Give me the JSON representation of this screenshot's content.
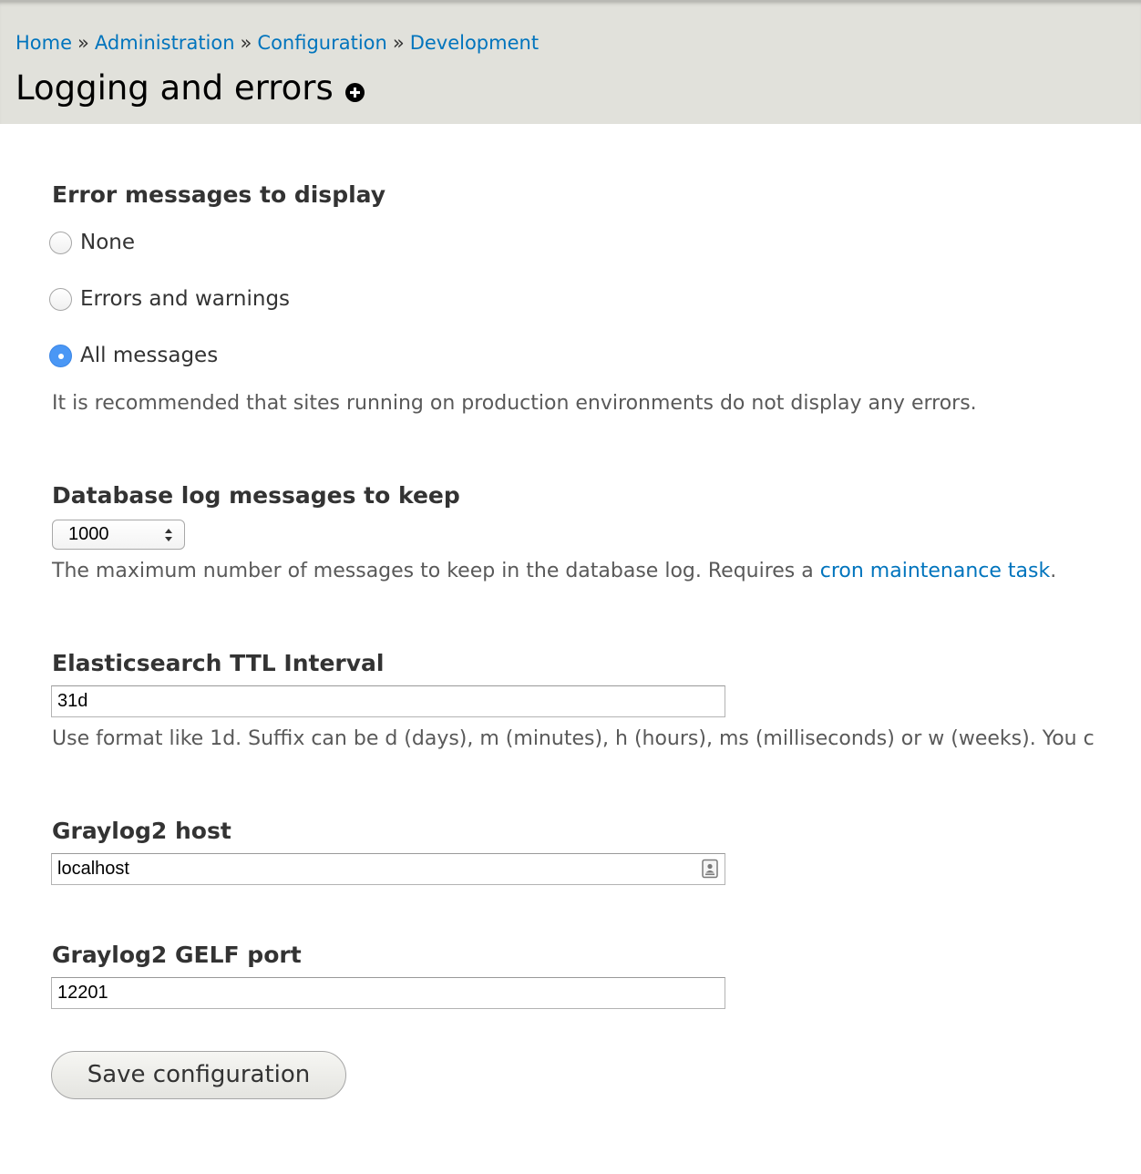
{
  "breadcrumb": {
    "items": [
      "Home",
      "Administration",
      "Configuration",
      "Development"
    ],
    "separator": "»"
  },
  "page": {
    "title": "Logging and errors"
  },
  "error_display": {
    "label": "Error messages to display",
    "options": [
      "None",
      "Errors and warnings",
      "All messages"
    ],
    "selected": "All messages",
    "description": "It is recommended that sites running on production environments do not display any errors."
  },
  "db_log": {
    "label": "Database log messages to keep",
    "value": "1000",
    "description_prefix": "The maximum number of messages to keep in the database log. Requires a ",
    "description_link": "cron maintenance task",
    "description_suffix": "."
  },
  "es_ttl": {
    "label": "Elasticsearch TTL Interval",
    "value": "31d",
    "description": "Use format like 1d. Suffix can be d (days), m (minutes), h (hours), ms (milliseconds) or w (weeks). You c"
  },
  "graylog_host": {
    "label": "Graylog2 host",
    "value": "localhost"
  },
  "graylog_port": {
    "label": "Graylog2 GELF port",
    "value": "12201"
  },
  "actions": {
    "save_label": "Save configuration"
  },
  "colors": {
    "link": "#0074bd",
    "header_bg": "#e1e1db",
    "radio_checked": "#4a97f5"
  }
}
